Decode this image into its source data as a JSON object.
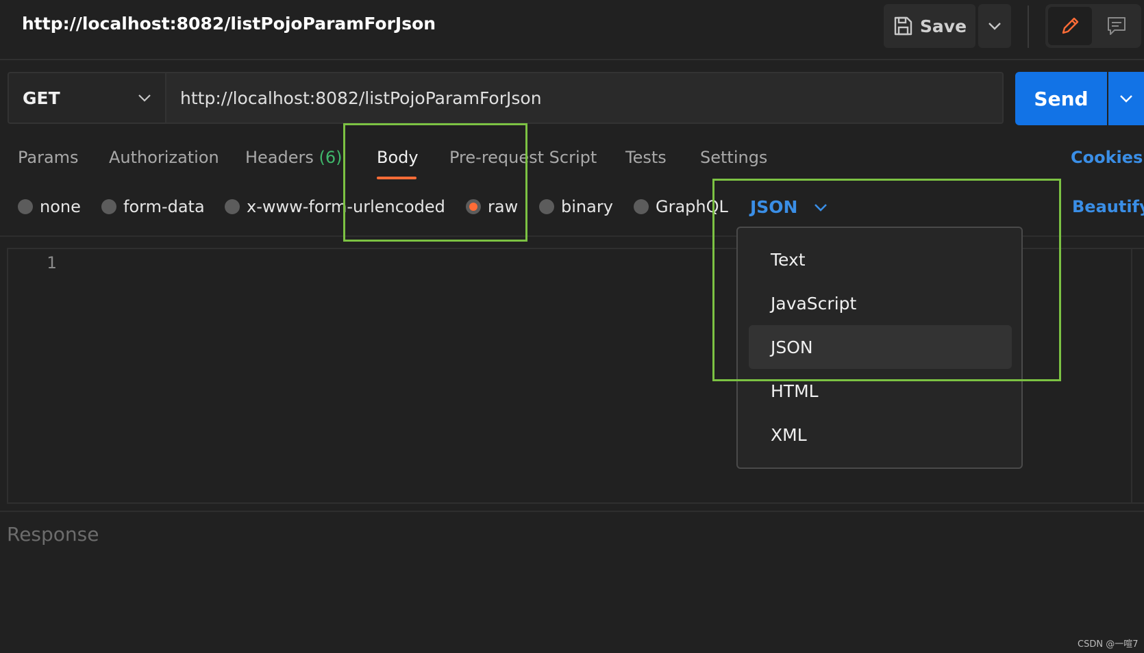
{
  "request": {
    "title": "http://localhost:8082/listPojoParamForJson",
    "method": "GET",
    "url": "http://localhost:8082/listPojoParamForJson"
  },
  "toolbar": {
    "save_label": "Save",
    "send_label": "Send"
  },
  "tabs": {
    "params": "Params",
    "authorization": "Authorization",
    "headers": "Headers",
    "headers_count": "(6)",
    "body": "Body",
    "pre_request": "Pre-request Script",
    "tests": "Tests",
    "settings": "Settings",
    "active": "Body"
  },
  "cookies_label": "Cookies",
  "body_types": {
    "options": [
      "none",
      "form-data",
      "x-www-form-urlencoded",
      "raw",
      "binary",
      "GraphQL"
    ],
    "selected": "raw",
    "language": "JSON",
    "beautify_label": "Beautify"
  },
  "language_menu": {
    "items": [
      "Text",
      "JavaScript",
      "JSON",
      "HTML",
      "XML"
    ],
    "selected": "JSON"
  },
  "editor": {
    "line_number": "1"
  },
  "response": {
    "label": "Response"
  },
  "watermark": "CSDN @一喧7",
  "colors": {
    "accent_orange": "#ff6c37",
    "link_blue": "#3a8ee6",
    "send_blue": "#1273e6",
    "highlight_green": "#7cc243",
    "count_green": "#3fb86b",
    "background": "#212121"
  }
}
